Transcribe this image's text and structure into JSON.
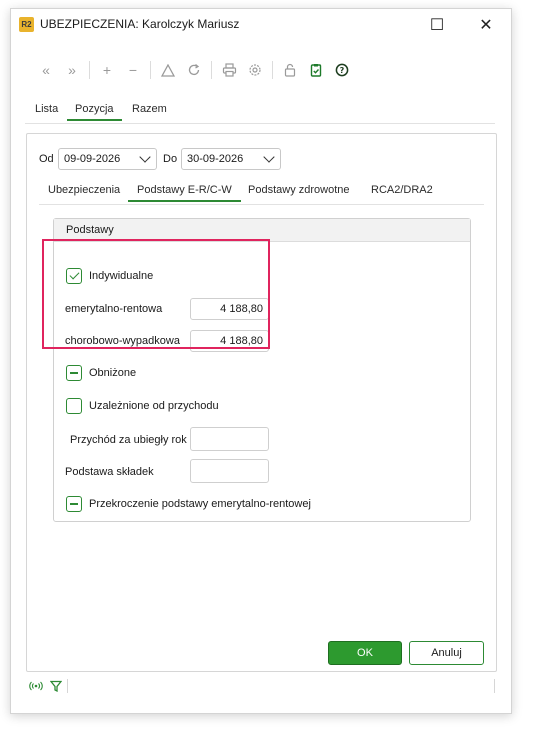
{
  "window": {
    "app_icon_text": "R2",
    "title": "UBEZPIECZENIA: Karolczyk Mariusz",
    "maximize_glyph": "☐",
    "close_glyph": "✕"
  },
  "toolbar": {
    "icons": [
      "first-icon",
      "prev-icon",
      "add-icon",
      "remove-icon",
      "warning-icon",
      "refresh-icon",
      "print-icon",
      "settings-icon",
      "lock-icon",
      "clipboard-icon",
      "help-icon"
    ]
  },
  "top_tabs": [
    {
      "label": "Lista"
    },
    {
      "label": "Pozycja",
      "active": true
    },
    {
      "label": "Razem"
    }
  ],
  "date_range": {
    "from_label": "Od",
    "from_value": "09-09-2026",
    "to_label": "Do",
    "to_value": "30-09-2026"
  },
  "inner_tabs": [
    {
      "label": "Ubezpieczenia"
    },
    {
      "label": "Podstawy E-R/C-W",
      "active": true
    },
    {
      "label": "Podstawy zdrowotne"
    },
    {
      "label": "RCA2/DRA2"
    }
  ],
  "podstawy": {
    "group_title": "Podstawy",
    "indywidualne_label": "Indywidualne",
    "indywidualne_checked": true,
    "emerytalno_label": "emerytalno-rentowa",
    "emerytalno_value": "4 188,80",
    "chorobowo_label": "chorobowo-wypadkowa",
    "chorobowo_value": "4 188,80",
    "obnizone_label": "Obniżone",
    "uzaleznione_label": "Uzależnione od przychodu",
    "przychod_label": "Przychód za ubiegły rok",
    "przychod_value": "",
    "podstawa_label": "Podstawa składek",
    "podstawa_value": "",
    "przekroczenie_label": "Przekroczenie podstawy emerytalno-rentowej"
  },
  "buttons": {
    "ok_label": "OK",
    "cancel_label": "Anuluj"
  },
  "colors": {
    "accent": "#2d8a34",
    "highlight": "#e0245e"
  }
}
